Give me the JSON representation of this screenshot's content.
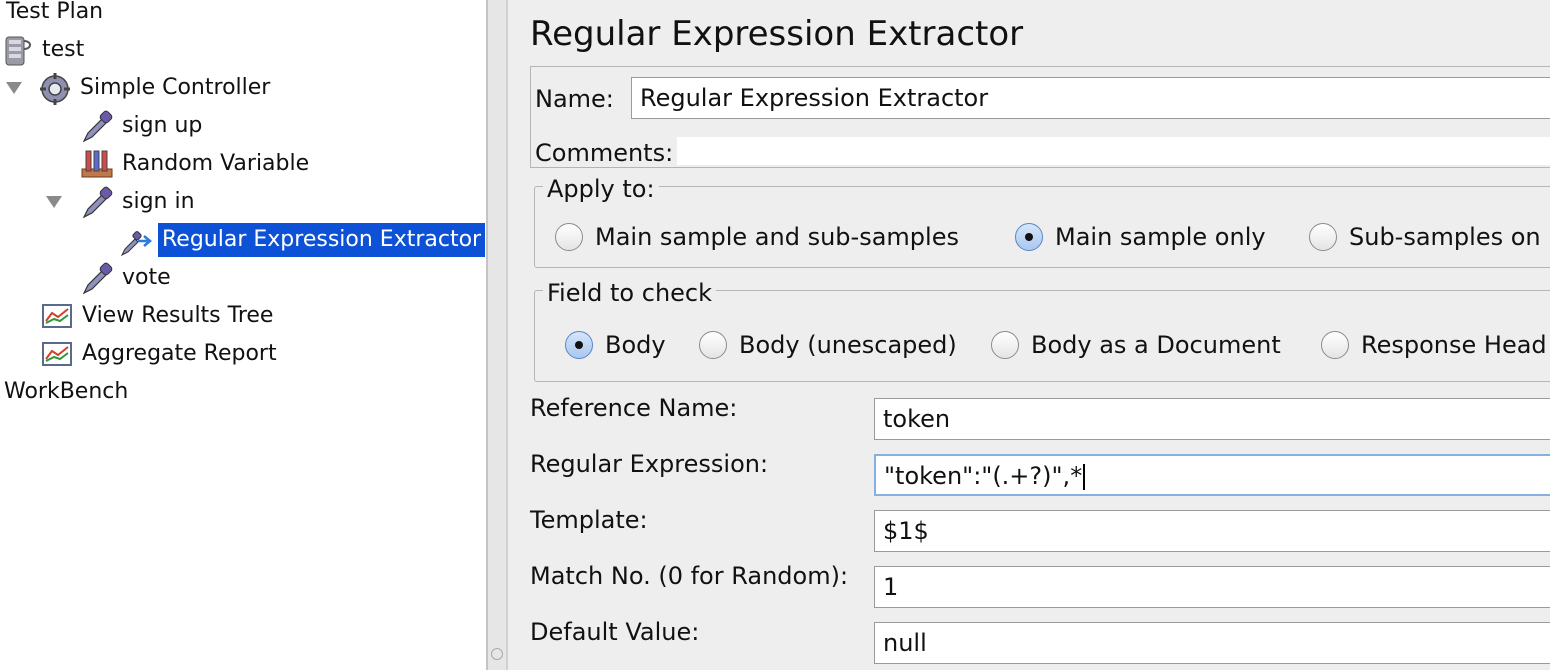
{
  "tree": {
    "items": [
      {
        "label": "Test Plan",
        "icon": "none"
      },
      {
        "label": "test",
        "icon": "thread-group-icon"
      },
      {
        "label": "Simple Controller",
        "icon": "controller-gear-icon",
        "expanded": true
      },
      {
        "label": "sign up",
        "icon": "http-sampler-pipette-icon"
      },
      {
        "label": "Random Variable",
        "icon": "config-element-icon"
      },
      {
        "label": "sign in",
        "icon": "http-sampler-pipette-icon",
        "expanded": true
      },
      {
        "label": "Regular Expression Extractor",
        "icon": "post-processor-icon",
        "selected": true
      },
      {
        "label": "vote",
        "icon": "http-sampler-pipette-icon"
      },
      {
        "label": "View Results Tree",
        "icon": "listener-graph-icon"
      },
      {
        "label": "Aggregate Report",
        "icon": "listener-graph-icon"
      },
      {
        "label": "WorkBench",
        "icon": "none"
      }
    ]
  },
  "panel": {
    "title": "Regular Expression Extractor",
    "name_label": "Name:",
    "name_value": "Regular Expression Extractor",
    "comments_label": "Comments:",
    "comments_value": "",
    "apply_to": {
      "legend": "Apply to:",
      "options": [
        "Main sample and sub-samples",
        "Main sample only",
        "Sub-samples on"
      ],
      "selected": 1
    },
    "field_to_check": {
      "legend": "Field to check",
      "options": [
        "Body",
        "Body (unescaped)",
        "Body as a Document",
        "Response Head"
      ],
      "selected": 0
    },
    "fields": [
      {
        "label": "Reference Name:",
        "value": "token"
      },
      {
        "label": "Regular Expression:",
        "value": "\"token\":\"(.+?)\",*"
      },
      {
        "label": "Template:",
        "value": "$1$"
      },
      {
        "label": "Match No. (0 for Random):",
        "value": "1"
      },
      {
        "label": "Default Value:",
        "value": "null"
      }
    ]
  },
  "colors": {
    "selection": "#0d52d6",
    "panel_bg": "#eeeeee"
  }
}
